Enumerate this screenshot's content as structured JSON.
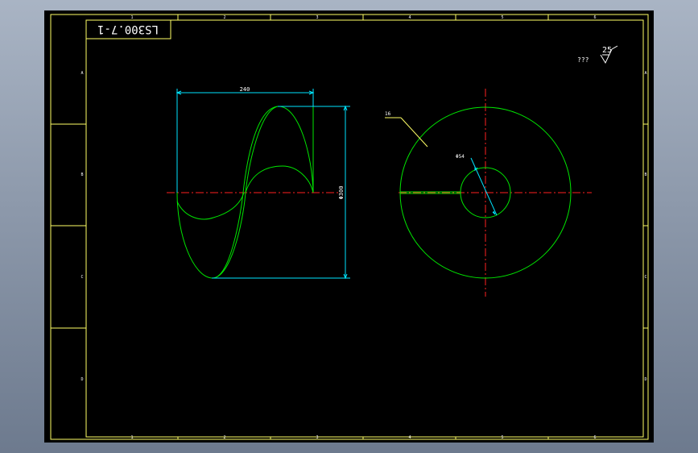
{
  "drawing": {
    "part_number": "LS300.7-1",
    "colors": {
      "background": "#000000",
      "frame": "#ffff66",
      "outline": "#00e600",
      "dimension": "#00e5ff",
      "centerline": "#ff2020",
      "leader": "#ffff66",
      "text": "#ffffff"
    },
    "column_zones": [
      "1",
      "2",
      "3",
      "4",
      "5",
      "6"
    ],
    "row_zones": [
      "A",
      "B",
      "C",
      "D"
    ],
    "roughness": {
      "note": "???",
      "value": "25"
    },
    "dimensions": {
      "length": "240",
      "outer_diameter": "Φ300",
      "inner_diameter": "Φ54"
    },
    "leader_label": "16"
  }
}
